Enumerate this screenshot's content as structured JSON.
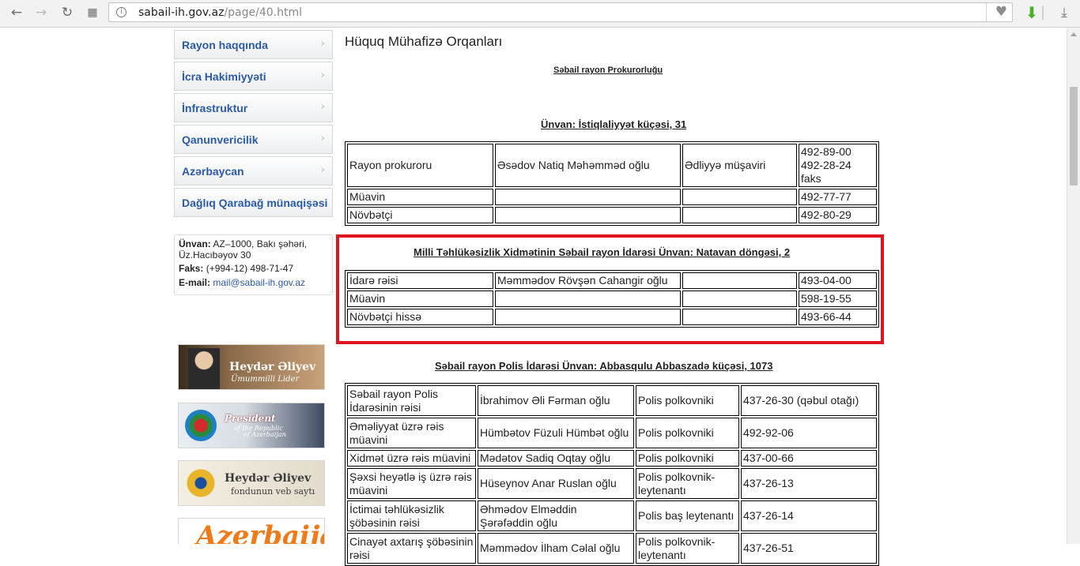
{
  "browser": {
    "url_domain": "sabail-ih.gov.az",
    "url_path": "/page/40.html",
    "site_info_icon": "i"
  },
  "sidebar": {
    "menu": [
      {
        "label": "Rayon haqqında"
      },
      {
        "label": "İcra Hakimiyyəti"
      },
      {
        "label": "İnfrastruktur"
      },
      {
        "label": "Qanunvericilik"
      },
      {
        "label": "Azərbaycan"
      },
      {
        "label": "Dağlıq Qarabağ münaqişəsi"
      }
    ],
    "contact": {
      "address_label": "Ünvan:",
      "address_line1": "AZ–1000, Bakı şəhəri,",
      "address_line2": "Üz.Hacıbəyov 30",
      "fax_label": "Faks:",
      "fax_value": "(+994-12) 498-71-47",
      "email_label": "E-mail:",
      "email_value": "mail@sabail-ih.gov.az"
    },
    "banners": {
      "b1_line1": "Heydər Əliyev",
      "b1_line2": "Ümummilli Lider",
      "b2_line1": "President",
      "b2_line2": "of the Republic",
      "b2_line3": "of Azerbaijan",
      "b3_line1": "Heydər Əliyev",
      "b3_line2": "fondunun veb saytı",
      "b4_text": "Azerbaijan"
    }
  },
  "main": {
    "title": "Hüquq Mühafizə Orqanları",
    "prosecutor": {
      "heading": "Səbail rayon Prokurorluğu",
      "address": "Ünvan: İstiqlaliyyət küçəsi, 31",
      "rows": [
        {
          "c1": "Rayon prokuroru",
          "c2": "Əsədov Natiq Məhəmməd oğlu",
          "c3": "Ədliyyə müşaviri",
          "c4a": "492-89-00",
          "c4b": "492-28-24 faks"
        },
        {
          "c1": "Müavin",
          "c2": "",
          "c3": "",
          "c4a": "492-77-77",
          "c4b": ""
        },
        {
          "c1": "Növbətçi",
          "c2": "",
          "c3": "",
          "c4a": "492-80-29",
          "c4b": ""
        }
      ]
    },
    "security": {
      "heading": "Milli Təhlükəsizlik Xidmətinin Səbail rayon İdarəsi",
      "address": "Ünvan: Natavan döngəsi, 2",
      "rows": [
        {
          "c1": "İdarə rəisi",
          "c2": "Məmmədov Rövşən Cahangir oğlu",
          "c3": "",
          "c4": "493-04-00"
        },
        {
          "c1": "Müavin",
          "c2": "",
          "c3": "",
          "c4": "598-19-55"
        },
        {
          "c1": "Növbətçi hissə",
          "c2": "",
          "c3": "",
          "c4": "493-66-44"
        }
      ]
    },
    "police": {
      "heading": "Səbail rayon Polis İdarəsi",
      "address": "Ünvan: Abbasqulu Abbaszadə küçəsi, 1073",
      "rows": [
        {
          "c1a": "Səbail rayon Polis",
          "c1b": "İdarəsinin rəisi",
          "c2a": "İbrahimov Əli Fərman oğlu",
          "c2b": "",
          "c3a": "Polis polkovniki",
          "c3b": "",
          "c4": "437-26-30 (qəbul otağı)"
        },
        {
          "c1a": "Əməliyyat üzrə rəis",
          "c1b": "müavini",
          "c2a": "Hümbətov Füzuli Hümbət oğlu",
          "c2b": "",
          "c3a": "Polis polkovniki",
          "c3b": "",
          "c4": "492-92-06"
        },
        {
          "c1a": "Xidmət üzrə rəis müavini",
          "c1b": "",
          "c2a": "Mədətov Sadiq Oqtay oğlu",
          "c2b": "",
          "c3a": "Polis polkovniki",
          "c3b": "",
          "c4": "437-00-66"
        },
        {
          "c1a": "Şəxsi heyətlə iş üzrə rəis",
          "c1b": "müavini",
          "c2a": "Hüseynov Anar Ruslan oğlu",
          "c2b": "",
          "c3a": "Polis polkovnik-",
          "c3b": "leytenantı",
          "c4": "437-26-13"
        },
        {
          "c1a": "İctimai təhlükəsizlik",
          "c1b": "şöbəsinin rəisi",
          "c2a": "Əhmədov Elməddin",
          "c2b": "Şərəfəddin oğlu",
          "c3a": "Polis baş leytenantı",
          "c3b": "",
          "c4": "437-26-14"
        },
        {
          "c1a": "Cinayət axtarış şöbəsinin",
          "c1b": "rəisi",
          "c2a": "Məmmədov İlham Cəlal oğlu",
          "c2b": "",
          "c3a": "Polis polkovnik-",
          "c3b": "leytenantı",
          "c4": "437-26-51"
        }
      ]
    }
  }
}
